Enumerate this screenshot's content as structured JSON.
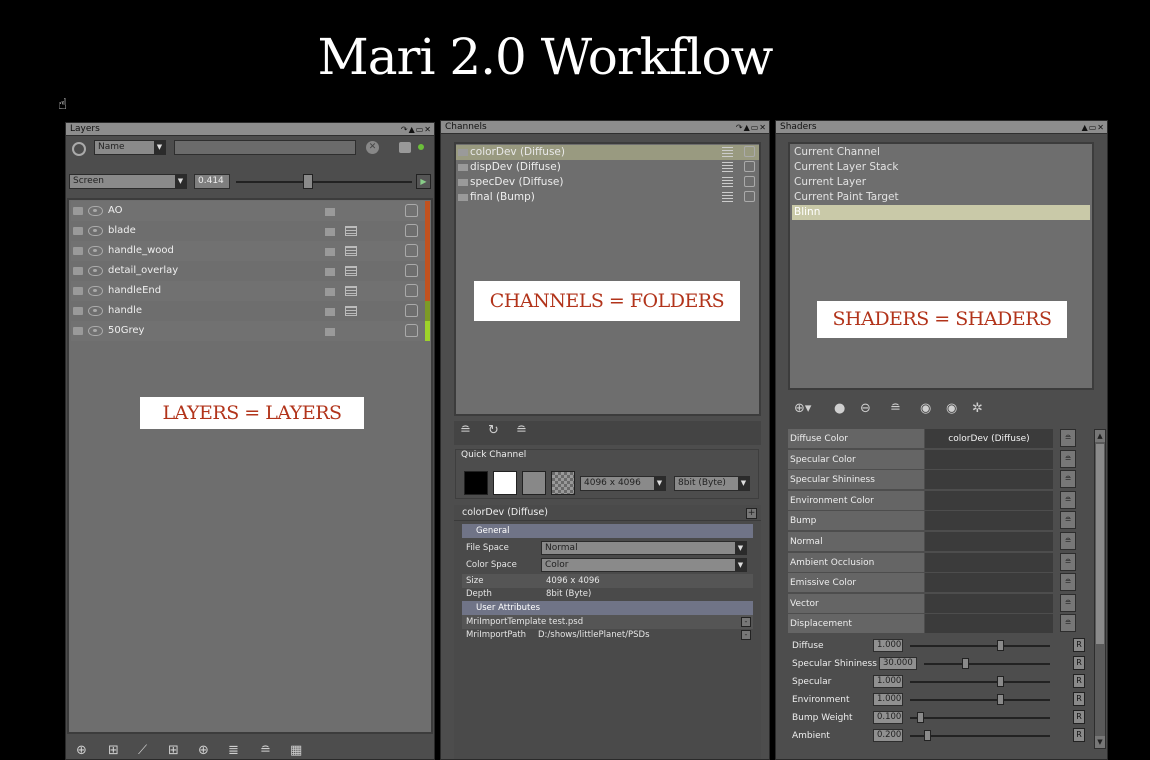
{
  "slide": {
    "title": "Mari 2.0 Workflow"
  },
  "layers_panel": {
    "title": "Layers",
    "filter": {
      "field": "Name"
    },
    "blend": {
      "mode": "Screen",
      "opacity": "0.414"
    },
    "rows": [
      {
        "name": "AO",
        "bar_color": "#c2521f"
      },
      {
        "name": "blade",
        "bar_color": "#c2521f"
      },
      {
        "name": "handle_wood",
        "bar_color": "#c2521f"
      },
      {
        "name": "detail_overlay",
        "bar_color": "#c2521f"
      },
      {
        "name": "handleEnd",
        "bar_color": "#c2521f"
      },
      {
        "name": "handle",
        "bar_color": "#7d9a26"
      },
      {
        "name": "50Grey",
        "bar_color": "#9ed32a"
      }
    ],
    "label": "LAYERS = LAYERS"
  },
  "channels_panel": {
    "title": "Channels",
    "rows": [
      {
        "name": "colorDev (Diffuse)",
        "selected": true
      },
      {
        "name": "dispDev (Diffuse)",
        "selected": false
      },
      {
        "name": "specDev (Diffuse)",
        "selected": false
      },
      {
        "name": "final (Bump)",
        "selected": false
      }
    ],
    "label": "CHANNELS = FOLDERS",
    "quick_channel": {
      "title": "Quick Channel",
      "size": "4096 x 4096",
      "depth": "8bit  (Byte)"
    },
    "properties": {
      "title": "colorDev (Diffuse)",
      "general": "General",
      "file_space_label": "File Space",
      "file_space": "Normal",
      "color_space_label": "Color Space",
      "color_space": "Color",
      "size_label": "Size",
      "size": "4096 x 4096",
      "depth_label": "Depth",
      "depth": "8bit  (Byte)",
      "user_attributes": "User Attributes",
      "attr1": "MriImportTemplate",
      "attr1_val": "test.psd",
      "attr2": "MriImportPath",
      "attr2_val": "D:/shows/littlePlanet/PSDs"
    }
  },
  "shaders_panel": {
    "title": "Shaders",
    "rows": [
      {
        "name": "Current Channel",
        "selected": false
      },
      {
        "name": "Current Layer Stack",
        "selected": false
      },
      {
        "name": "Current Layer",
        "selected": false
      },
      {
        "name": "Current Paint Target",
        "selected": false
      },
      {
        "name": "Blinn",
        "selected": true
      }
    ],
    "label": "SHADERS = SHADERS",
    "inputs": [
      {
        "name": "Diffuse Color",
        "value": "colorDev (Diffuse)"
      },
      {
        "name": "Specular Color",
        "value": ""
      },
      {
        "name": "Specular Shininess",
        "value": ""
      },
      {
        "name": "Environment Color",
        "value": ""
      },
      {
        "name": "Bump",
        "value": ""
      },
      {
        "name": "Normal",
        "value": ""
      },
      {
        "name": "Ambient Occlusion",
        "value": ""
      },
      {
        "name": "Emissive Color",
        "value": ""
      },
      {
        "name": "Vector",
        "value": ""
      },
      {
        "name": "Displacement",
        "value": ""
      }
    ],
    "sliders": [
      {
        "name": "Diffuse",
        "value": "1.000",
        "level": 0.62
      },
      {
        "name": "Specular Shininess",
        "value": "30.000",
        "level": 0.3
      },
      {
        "name": "Specular",
        "value": "1.000",
        "level": 0.62
      },
      {
        "name": "Environment",
        "value": "1.000",
        "level": 0.62
      },
      {
        "name": "Bump Weight",
        "value": "0.100",
        "level": 0.05
      },
      {
        "name": "Ambient",
        "value": "0.200",
        "level": 0.1
      }
    ],
    "reset_label": "R"
  }
}
